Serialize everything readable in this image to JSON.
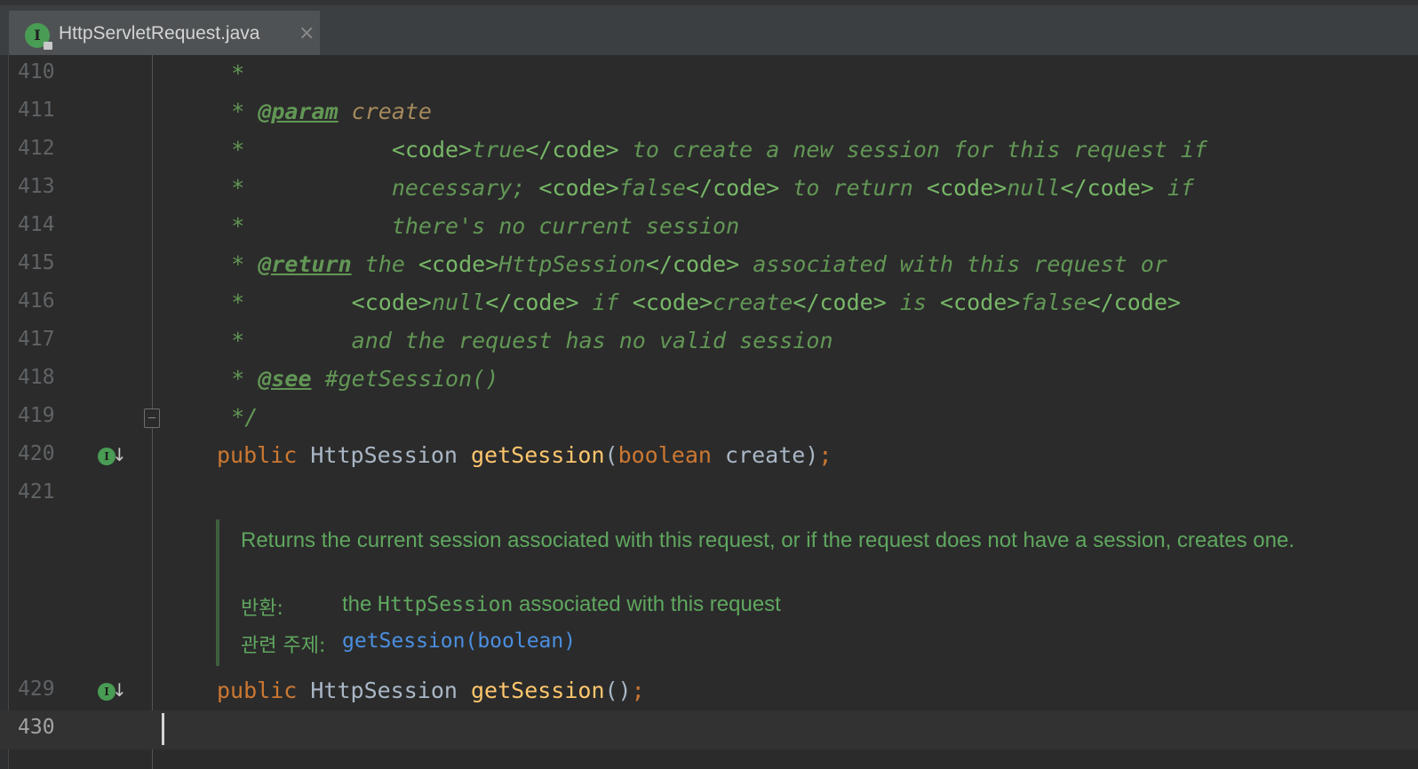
{
  "tab": {
    "icon": "interface-icon",
    "title": "HttpServletRequest.java",
    "close_glyph": "×"
  },
  "lines": [
    {
      "num": "410",
      "text": "    *"
    },
    {
      "num": "411",
      "star": "    * ",
      "tag": "@param",
      "pname": " create"
    },
    {
      "num": "412",
      "parts": [
        {
          "c": "doc",
          "t": "    *           "
        },
        {
          "c": "html",
          "t": "<code>"
        },
        {
          "c": "doc",
          "t": "true"
        },
        {
          "c": "html",
          "t": "</code>"
        },
        {
          "c": "doc",
          "t": " to create a new session for this request if"
        }
      ]
    },
    {
      "num": "413",
      "parts": [
        {
          "c": "doc",
          "t": "    *           necessary; "
        },
        {
          "c": "html",
          "t": "<code>"
        },
        {
          "c": "doc",
          "t": "false"
        },
        {
          "c": "html",
          "t": "</code>"
        },
        {
          "c": "doc",
          "t": " to return "
        },
        {
          "c": "html",
          "t": "<code>"
        },
        {
          "c": "doc",
          "t": "null"
        },
        {
          "c": "html",
          "t": "</code>"
        },
        {
          "c": "doc",
          "t": " if"
        }
      ]
    },
    {
      "num": "414",
      "text": "    *           there's no current session"
    },
    {
      "num": "415",
      "parts": [
        {
          "c": "doc",
          "t": "    * "
        },
        {
          "c": "tag",
          "t": "@return"
        },
        {
          "c": "doc",
          "t": " the "
        },
        {
          "c": "html",
          "t": "<code>"
        },
        {
          "c": "doc",
          "t": "HttpSession"
        },
        {
          "c": "html",
          "t": "</code>"
        },
        {
          "c": "doc",
          "t": " associated with this request or"
        }
      ]
    },
    {
      "num": "416",
      "parts": [
        {
          "c": "doc",
          "t": "    *        "
        },
        {
          "c": "html",
          "t": "<code>"
        },
        {
          "c": "doc",
          "t": "null"
        },
        {
          "c": "html",
          "t": "</code>"
        },
        {
          "c": "doc",
          "t": " if "
        },
        {
          "c": "html",
          "t": "<code>"
        },
        {
          "c": "doc",
          "t": "create"
        },
        {
          "c": "html",
          "t": "</code>"
        },
        {
          "c": "doc",
          "t": " is "
        },
        {
          "c": "html",
          "t": "<code>"
        },
        {
          "c": "doc",
          "t": "false"
        },
        {
          "c": "html",
          "t": "</code>"
        }
      ]
    },
    {
      "num": "417",
      "text": "    *        and the request has no valid session"
    },
    {
      "num": "418",
      "parts": [
        {
          "c": "doc",
          "t": "    * "
        },
        {
          "c": "tag",
          "t": "@see"
        },
        {
          "c": "doc",
          "t": " #getSession()"
        }
      ]
    },
    {
      "num": "419",
      "text": "    */"
    },
    {
      "num": "420",
      "parts": [
        {
          "c": "kw",
          "t": "public "
        },
        {
          "c": "type",
          "t": "HttpSession "
        },
        {
          "c": "fn",
          "t": "getSession"
        },
        {
          "c": "plain",
          "t": "("
        },
        {
          "c": "kw",
          "t": "boolean "
        },
        {
          "c": "plain",
          "t": "create)"
        },
        {
          "c": "kw",
          "t": ";"
        }
      ]
    },
    {
      "num": "421",
      "text": ""
    },
    {
      "num": "429",
      "parts": [
        {
          "c": "kw",
          "t": "public "
        },
        {
          "c": "type",
          "t": "HttpSession "
        },
        {
          "c": "fn",
          "t": "getSession"
        },
        {
          "c": "plain",
          "t": "()"
        },
        {
          "c": "kw",
          "t": ";"
        }
      ]
    },
    {
      "num": "430",
      "text": ""
    }
  ],
  "rendered_doc": {
    "description": "Returns the current session associated with this request, or if the request does not have a session, creates one.",
    "returns_label": "반환:",
    "returns_pre": "the ",
    "returns_code": "HttpSession",
    "returns_post": " associated with this request",
    "see_label": "관련 주제:",
    "see_link": "getSession(boolean)"
  },
  "gutter_icons": {
    "420": "implemented-interface-icon",
    "429": "implemented-interface-icon"
  },
  "colors": {
    "background": "#2b2b2b",
    "doc_comment": "#629755",
    "keyword": "#cc7832",
    "method": "#ffc66d",
    "link": "#4b8fe0",
    "tab_underline": "#3f8bd4"
  }
}
